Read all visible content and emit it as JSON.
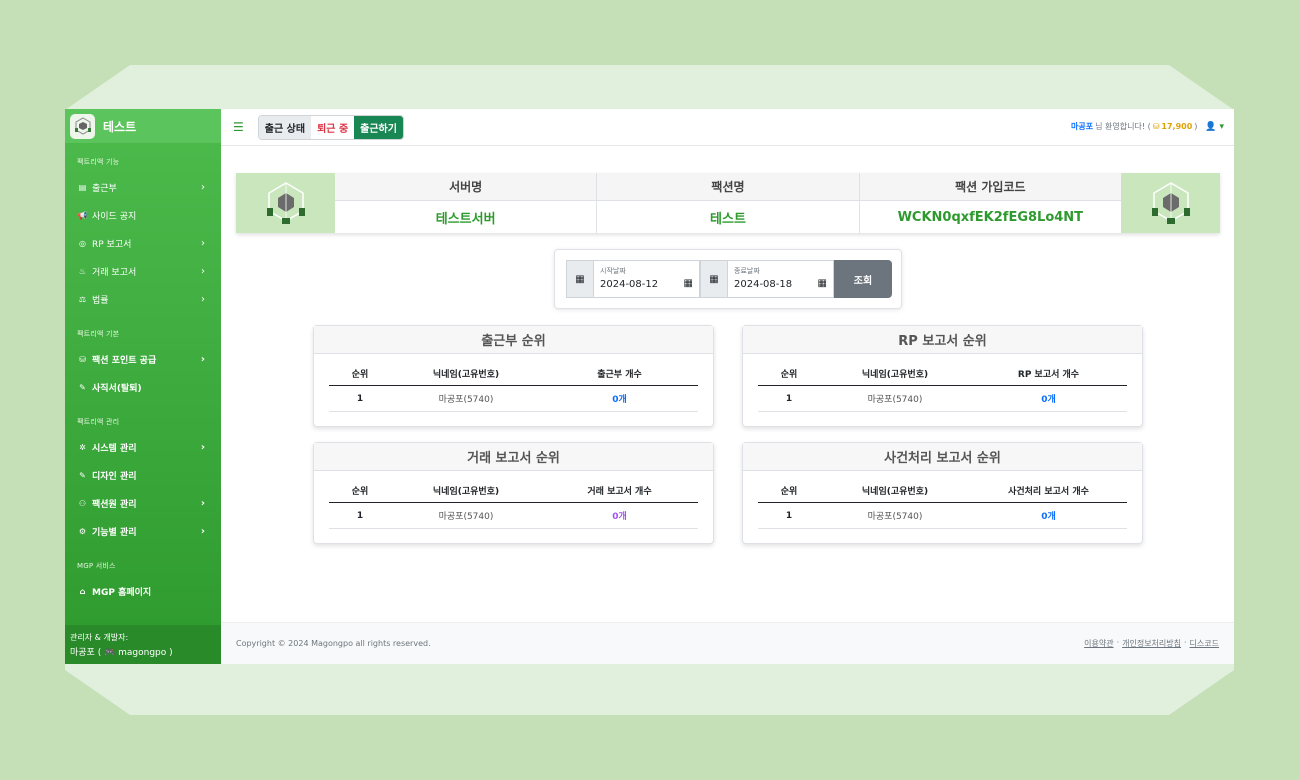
{
  "brand": {
    "name": "테스트"
  },
  "sidebar": {
    "sections": [
      {
        "label": "팩트리액 기능",
        "items": [
          {
            "icon": "book-icon",
            "glyph": "▤",
            "label": "출근부",
            "chevron": true
          },
          {
            "icon": "megaphone-icon",
            "glyph": "📢",
            "label": "사이드 공지",
            "chevron": false
          },
          {
            "icon": "gamepad-icon",
            "glyph": "◎",
            "label": "RP 보고서",
            "chevron": true
          },
          {
            "icon": "money-bag-icon",
            "glyph": "♨",
            "label": "거래 보고서",
            "chevron": true
          },
          {
            "icon": "scale-icon",
            "glyph": "⚖",
            "label": "법률",
            "chevron": true
          }
        ]
      },
      {
        "label": "팩트리액 기본",
        "items": [
          {
            "icon": "coins-icon",
            "glyph": "⛁",
            "label": "팩션 포인트 공급",
            "chevron": true
          },
          {
            "icon": "feather-icon",
            "glyph": "✎",
            "label": "사직서(탈퇴)",
            "chevron": false
          }
        ]
      },
      {
        "label": "팩트리액 관리",
        "items": [
          {
            "icon": "gear-icon",
            "glyph": "✲",
            "label": "시스템 관리",
            "chevron": true
          },
          {
            "icon": "brush-icon",
            "glyph": "✎",
            "label": "디자인 관리",
            "chevron": false
          },
          {
            "icon": "users-icon",
            "glyph": "⚇",
            "label": "팩션원 관리",
            "chevron": true
          },
          {
            "icon": "gears-icon",
            "glyph": "⚙",
            "label": "기능별 관리",
            "chevron": true
          }
        ]
      },
      {
        "label": "MGP 서비스",
        "items": [
          {
            "icon": "home-icon",
            "glyph": "⌂",
            "label": "MGP 홈페이지",
            "chevron": false
          }
        ]
      }
    ],
    "admin_line1": "관리자 & 개발자:",
    "admin_line2": "마공포 ( 🎮 magongpo )"
  },
  "topbar": {
    "status_label": "출근 상태",
    "status_value": "퇴근 중",
    "checkin_button": "출근하기",
    "user_name": "마공포",
    "welcome_text": "님 환영합니다! (",
    "points": "17,900",
    "close_paren": ")"
  },
  "info": {
    "headers": [
      "서버명",
      "팩션명",
      "팩션 가입코드"
    ],
    "values": [
      "테스트서버",
      "테스트",
      "WCKN0qxfEK2fEG8Lo4NT"
    ]
  },
  "date_filter": {
    "start_label": "시작날짜",
    "start_value": "2024-08-12",
    "end_label": "종료날짜",
    "end_value": "2024-08-18",
    "search_button": "조회"
  },
  "rankings": [
    {
      "title": "출근부 순위",
      "cols": [
        "순위",
        "닉네임(고유번호)",
        "출근부 개수"
      ],
      "rows": [
        [
          "1",
          "마공포(5740)",
          "0개"
        ]
      ],
      "color": "blue"
    },
    {
      "title": "RP 보고서 순위",
      "cols": [
        "순위",
        "닉네임(고유번호)",
        "RP 보고서 개수"
      ],
      "rows": [
        [
          "1",
          "마공포(5740)",
          "0개"
        ]
      ],
      "color": "blue"
    },
    {
      "title": "거래 보고서 순위",
      "cols": [
        "순위",
        "닉네임(고유번호)",
        "거래 보고서 개수"
      ],
      "rows": [
        [
          "1",
          "마공포(5740)",
          "0개"
        ]
      ],
      "color": "purple"
    },
    {
      "title": "사건처리 보고서 순위",
      "cols": [
        "순위",
        "닉네임(고유번호)",
        "사건처리 보고서 개수"
      ],
      "rows": [
        [
          "1",
          "마공포(5740)",
          "0개"
        ]
      ],
      "color": "blue"
    }
  ],
  "footer": {
    "copyright": "Copyright © 2024 Magongpo all rights reserved.",
    "links": [
      "이용약관",
      "개인정보처리방침",
      "디스코드"
    ],
    "separator": "·"
  }
}
